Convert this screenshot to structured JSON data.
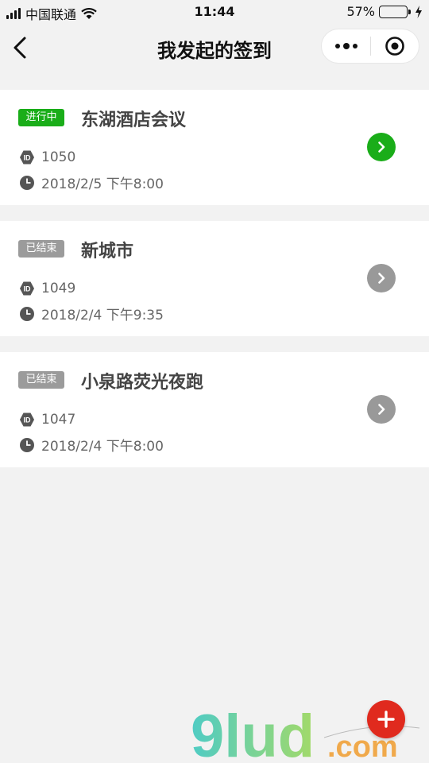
{
  "status_bar": {
    "carrier": "中国联通",
    "time": "11:44",
    "battery_percent": "57%",
    "battery_level": 0.57
  },
  "nav": {
    "title": "我发起的签到",
    "icons": [
      "back-icon",
      "more-icon",
      "target-icon"
    ]
  },
  "checkins": [
    {
      "status": "进行中",
      "status_type": "active",
      "title": "东湖酒店会议",
      "id": "1050",
      "time": "2018/2/5 下午8:00"
    },
    {
      "status": "已结束",
      "status_type": "ended",
      "title": "新城市",
      "id": "1049",
      "time": "2018/2/4 下午9:35"
    },
    {
      "status": "已结束",
      "status_type": "ended",
      "title": "小泉路荧光夜跑",
      "id": "1047",
      "time": "2018/2/4 下午8:00"
    }
  ],
  "colors": {
    "active": "#1aad19",
    "ended": "#9b9b9b",
    "fab": "#e02a1e"
  },
  "watermark": {
    "brand": "9lud",
    "suffix": ".com"
  }
}
